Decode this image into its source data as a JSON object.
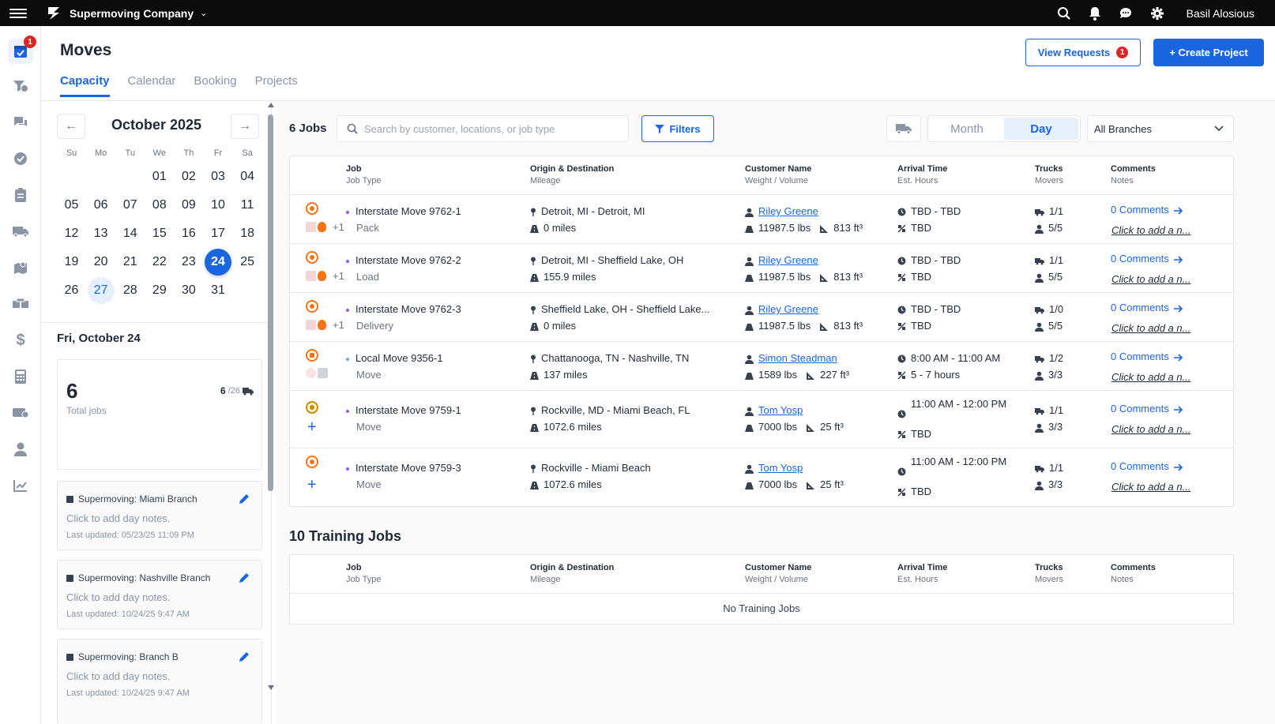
{
  "topbar": {
    "company": "Supermoving Company",
    "user": "Basil Alosious"
  },
  "rail": {
    "badge": "1"
  },
  "page": {
    "title": "Moves"
  },
  "tabs": [
    {
      "label": "Capacity",
      "active": true
    },
    {
      "label": "Calendar"
    },
    {
      "label": "Booking"
    },
    {
      "label": "Projects"
    }
  ],
  "actions": {
    "view_requests": "View Requests",
    "requests_count": "1",
    "create_project": "+ Create Project"
  },
  "calendar": {
    "month": "October 2025",
    "weekdays": [
      "Su",
      "Mo",
      "Tu",
      "We",
      "Th",
      "Fr",
      "Sa"
    ],
    "weeks": [
      [
        "",
        "",
        "",
        "01",
        "02",
        "03",
        "04"
      ],
      [
        "05",
        "06",
        "07",
        "08",
        "09",
        "10",
        "11"
      ],
      [
        "12",
        "13",
        "14",
        "15",
        "16",
        "17",
        "18"
      ],
      [
        "19",
        "20",
        "21",
        "22",
        "23",
        "24",
        "25"
      ],
      [
        "26",
        "27",
        "28",
        "29",
        "30",
        "31",
        ""
      ]
    ],
    "selected_day": "24",
    "today": "27"
  },
  "day_summary": {
    "date_label": "Fri, October 24",
    "total": "6",
    "total_label": "Total jobs",
    "trucks_used": "6",
    "trucks_total": "/26"
  },
  "branch_notes": [
    {
      "branch": "Supermoving: Miami Branch",
      "prompt": "Click to add day notes.",
      "updated": "Last updated: 05/23/25 11:09 PM"
    },
    {
      "branch": "Supermoving: Nashville Branch",
      "prompt": "Click to add day notes.",
      "updated": "Last updated: 10/24/25 9:47 AM"
    },
    {
      "branch": "Supermoving: Branch B",
      "prompt": "Click to add day notes.",
      "updated": "Last updated: 10/24/25 9:47 AM"
    }
  ],
  "toolbar": {
    "jobs_count": "6 Jobs",
    "search_placeholder": "Search by customer, locations, or job type",
    "filters": "Filters",
    "view_month": "Month",
    "view_day": "Day",
    "branch": "All Branches"
  },
  "columns": [
    {
      "a": "Job",
      "b": "Job Type"
    },
    {
      "a": "Origin & Destination",
      "b": "Mileage"
    },
    {
      "a": "Customer Name",
      "b": "Weight / Volume"
    },
    {
      "a": "Arrival Time",
      "b": "Est. Hours"
    },
    {
      "a": "Trucks",
      "b": "Movers"
    },
    {
      "a": "Comments",
      "b": "Notes"
    }
  ],
  "jobs": [
    {
      "name": "Interstate Move 9762-1",
      "type": "Pack",
      "extra": "+1",
      "route": "Detroit, MI - Detroit, MI",
      "miles": "0 miles",
      "customer": "Riley Greene",
      "weight": "11987.5 lbs",
      "volume": "813 ft³",
      "arrival": "TBD - TBD",
      "hours": "TBD",
      "trucks": "1/1",
      "movers": "5/5",
      "comments": "0 Comments",
      "note": "Click to add a n..."
    },
    {
      "name": "Interstate Move 9762-2",
      "type": "Load",
      "extra": "+1",
      "route": "Detroit, MI - Sheffield Lake, OH",
      "miles": "155.9 miles",
      "customer": "Riley Greene",
      "weight": "11987.5 lbs",
      "volume": "813 ft³",
      "arrival": "TBD - TBD",
      "hours": "TBD",
      "trucks": "1/1",
      "movers": "5/5",
      "comments": "0 Comments",
      "note": "Click to add a n..."
    },
    {
      "name": "Interstate Move 9762-3",
      "type": "Delivery",
      "extra": "+1",
      "route": "Sheffield Lake, OH - Sheffield Lake...",
      "miles": "0 miles",
      "customer": "Riley Greene",
      "weight": "11987.5 lbs",
      "volume": "813 ft³",
      "arrival": "TBD - TBD",
      "hours": "TBD",
      "trucks": "1/0",
      "movers": "5/5",
      "comments": "0 Comments",
      "note": "Click to add a n..."
    },
    {
      "name": "Local Move 9356-1",
      "type": "Move",
      "extra": "",
      "route": "Chattanooga, TN - Nashville, TN",
      "miles": "137 miles",
      "customer": "Simon Steadman",
      "weight": "1589 lbs",
      "volume": "227 ft³",
      "arrival": "8:00 AM - 11:00 AM",
      "hours": "5 - 7 hours",
      "trucks": "1/2",
      "movers": "3/3",
      "comments": "0 Comments",
      "note": "Click to add a n..."
    },
    {
      "name": "Interstate Move 9759-1",
      "type": "Move",
      "extra": "",
      "route": "Rockville, MD - Miami Beach, FL",
      "miles": "1072.6 miles",
      "customer": "Tom Yosp",
      "weight": "7000 lbs",
      "volume": "25 ft³",
      "arrival": "11:00 AM - 12:00 PM",
      "hours": "TBD",
      "trucks": "1/1",
      "movers": "3/3",
      "comments": "0 Comments",
      "note": "Click to add a n..."
    },
    {
      "name": "Interstate Move 9759-3",
      "type": "Move",
      "extra": "",
      "route": "Rockville - Miami Beach",
      "miles": "1072.6 miles",
      "customer": "Tom Yosp",
      "weight": "7000 lbs",
      "volume": "25 ft³",
      "arrival": "11:00 AM - 12:00 PM",
      "hours": "TBD",
      "trucks": "1/1",
      "movers": "3/3",
      "comments": "0 Comments",
      "note": "Click to add a n..."
    }
  ],
  "training": {
    "title": "10 Training Jobs",
    "empty": "No Training Jobs"
  }
}
